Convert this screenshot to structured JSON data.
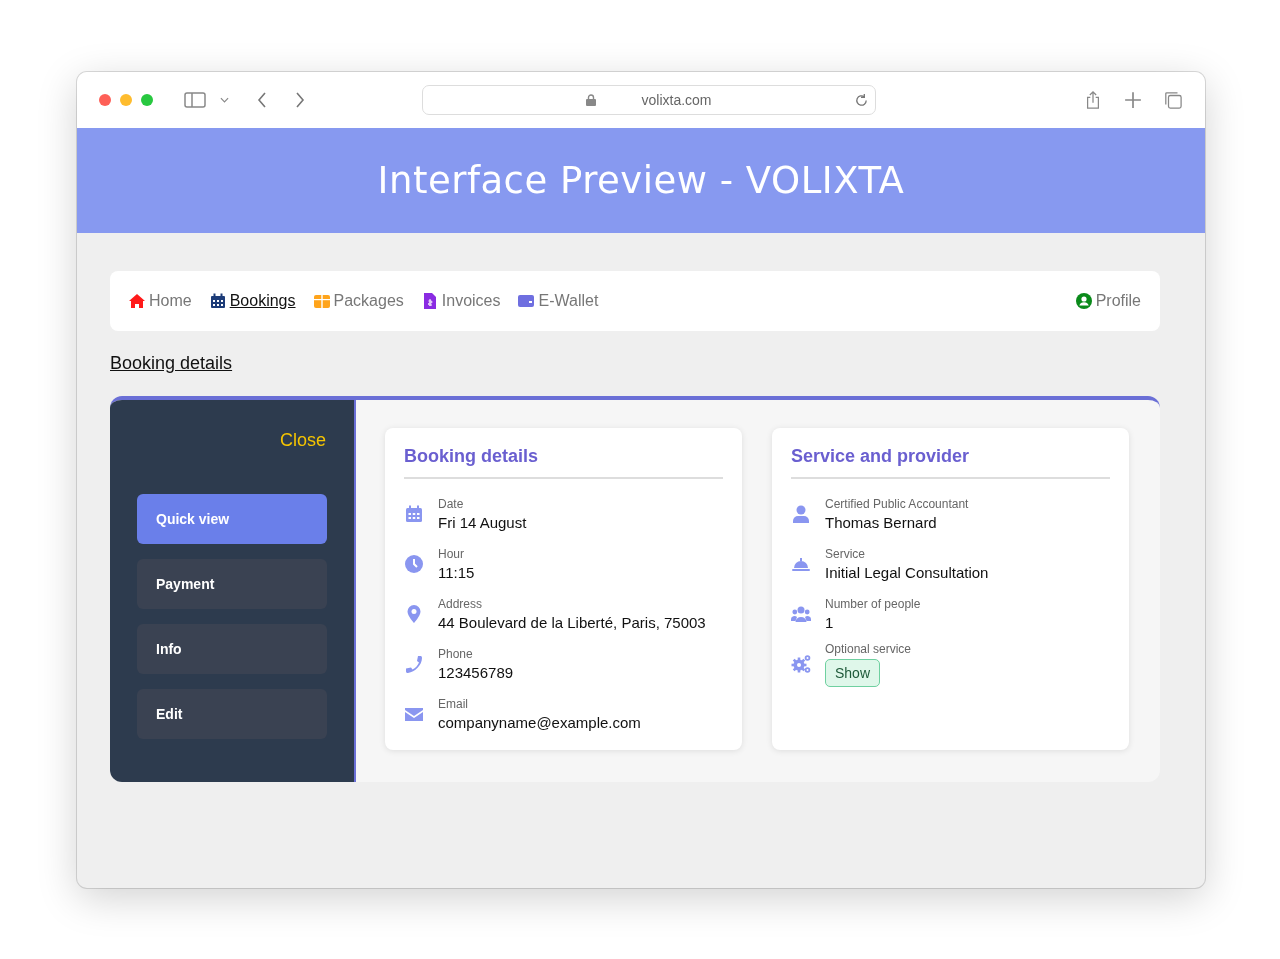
{
  "browser": {
    "url": "volixta.com"
  },
  "header": {
    "title": "Interface Preview - VOLIXTA"
  },
  "nav": {
    "items": [
      {
        "label": "Home",
        "kind": "home",
        "selected": false
      },
      {
        "label": "Bookings",
        "kind": "calendar",
        "selected": true
      },
      {
        "label": "Packages",
        "kind": "box",
        "selected": false
      },
      {
        "label": "Invoices",
        "kind": "invoice",
        "selected": false
      },
      {
        "label": "E-Wallet",
        "kind": "wallet",
        "selected": false
      }
    ],
    "profile": "Profile"
  },
  "breadcrumb": "Booking details",
  "side_menu": {
    "close": "Close",
    "items": [
      {
        "label": "Quick view",
        "selected": true
      },
      {
        "label": "Payment",
        "selected": false
      },
      {
        "label": "Info",
        "selected": false
      },
      {
        "label": "Edit",
        "selected": false
      }
    ]
  },
  "cards": [
    {
      "title": "Booking details",
      "rows": [
        {
          "kind": "calendar",
          "label": "Date",
          "value": "Fri 14 August"
        },
        {
          "kind": "clock",
          "label": "Hour",
          "value": "11:15"
        },
        {
          "kind": "pin",
          "label": "Address",
          "value": "44 Boulevard de la Liberté, Paris, 75003"
        },
        {
          "kind": "phone",
          "label": "Phone",
          "value": "123456789"
        },
        {
          "kind": "mail",
          "label": "Email",
          "value": "companyname@example.com"
        }
      ]
    },
    {
      "title": "Service and provider",
      "rows": [
        {
          "kind": "person",
          "label": "Certified Public Accountant",
          "value": "Thomas Bernard"
        },
        {
          "kind": "bell",
          "label": "Service",
          "value": "Initial Legal Consultation"
        },
        {
          "kind": "people",
          "label": "Number of people",
          "value": "1"
        },
        {
          "kind": "gears",
          "label": "Optional service",
          "button": "Show"
        }
      ]
    }
  ]
}
